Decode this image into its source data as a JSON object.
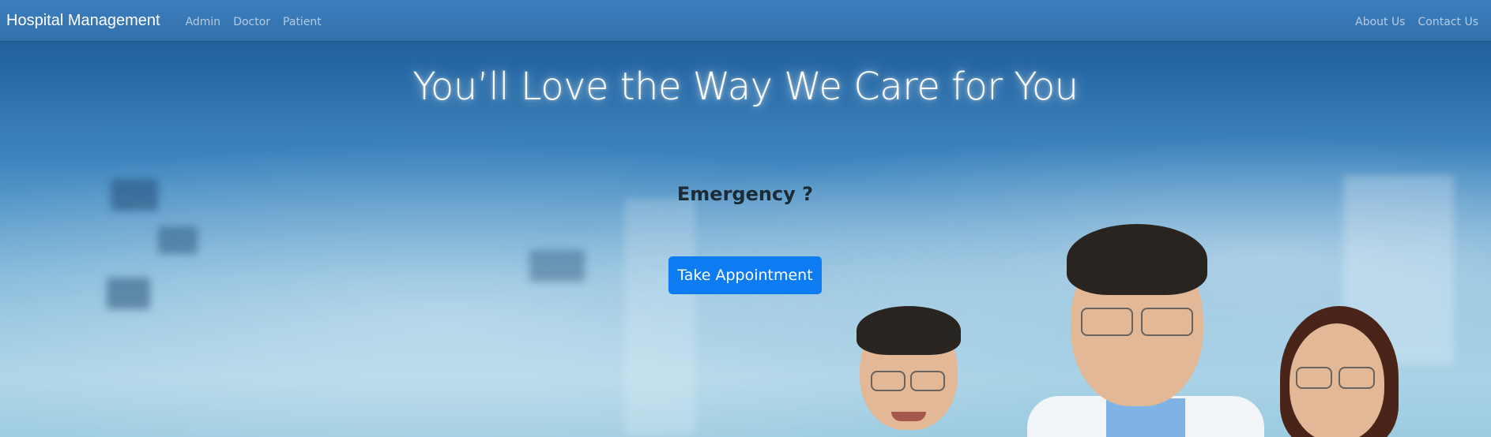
{
  "navbar": {
    "brand": "Hospital Management",
    "left_links": [
      {
        "label": "Admin"
      },
      {
        "label": "Doctor"
      },
      {
        "label": "Patient"
      }
    ],
    "right_links": [
      {
        "label": "About Us"
      },
      {
        "label": "Contact Us"
      }
    ]
  },
  "hero": {
    "headline": "You’ll Love the Way We Care for You",
    "emergency_label": "Emergency ?",
    "appointment_button": "Take Appointment"
  },
  "colors": {
    "navbar": "#3a7fc0",
    "button": "#0d7cf2",
    "headline_text": "#ffffff",
    "emergency_text": "#1d2b36"
  }
}
